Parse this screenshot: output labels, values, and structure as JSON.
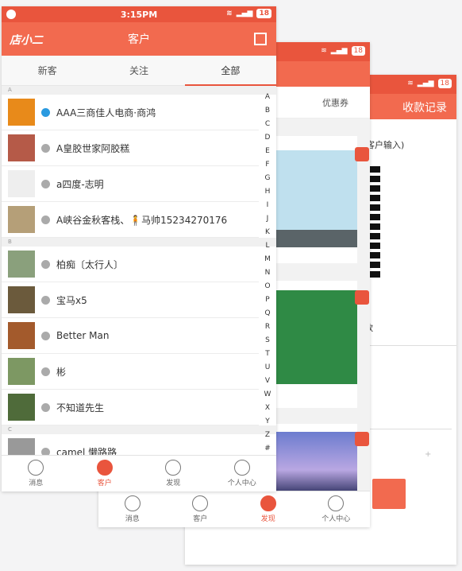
{
  "back_phone": {
    "header_title": "收款记录",
    "hint": "客户输入)",
    "sub": "款",
    "badge": "18",
    "plus": "+"
  },
  "middle_phone": {
    "tab_coupon": "优惠券",
    "badge": "18",
    "tabbar": [
      "消息",
      "客户",
      "发现",
      "个人中心"
    ]
  },
  "front_phone": {
    "status_time": "3:15PM",
    "badge": "18",
    "logo": "店小二",
    "title": "客户",
    "tabs": [
      "新客",
      "关注",
      "全部"
    ],
    "sections": [
      {
        "letter": "A",
        "items": [
          {
            "name": "AAA三商佳人电商·商鸿",
            "verified": true
          },
          {
            "name": "A皇胶世家阿胶糕",
            "verified": false
          },
          {
            "name": "a四度-志明",
            "verified": false
          },
          {
            "name": "A峡谷金秋客栈、🧍马帅15234270176",
            "verified": false
          }
        ]
      },
      {
        "letter": "B",
        "items": [
          {
            "name": "柏痴〔太行人〕",
            "verified": false
          },
          {
            "name": "宝马x5",
            "verified": false
          },
          {
            "name": "Better Man",
            "verified": false
          },
          {
            "name": "彬",
            "verified": false
          },
          {
            "name": "不知道先生",
            "verified": false
          }
        ]
      },
      {
        "letter": "C",
        "items": [
          {
            "name": "camel 懒路路",
            "verified": false
          }
        ]
      }
    ],
    "alphabet": [
      "A",
      "B",
      "C",
      "D",
      "E",
      "F",
      "G",
      "H",
      "I",
      "J",
      "K",
      "L",
      "M",
      "N",
      "O",
      "P",
      "Q",
      "R",
      "S",
      "T",
      "U",
      "V",
      "W",
      "X",
      "Y",
      "Z",
      "#"
    ],
    "tabbar": [
      "消息",
      "客户",
      "发现",
      "个人中心"
    ]
  },
  "colors": {
    "accent": "#f26a4f",
    "status": "#e9553d"
  }
}
